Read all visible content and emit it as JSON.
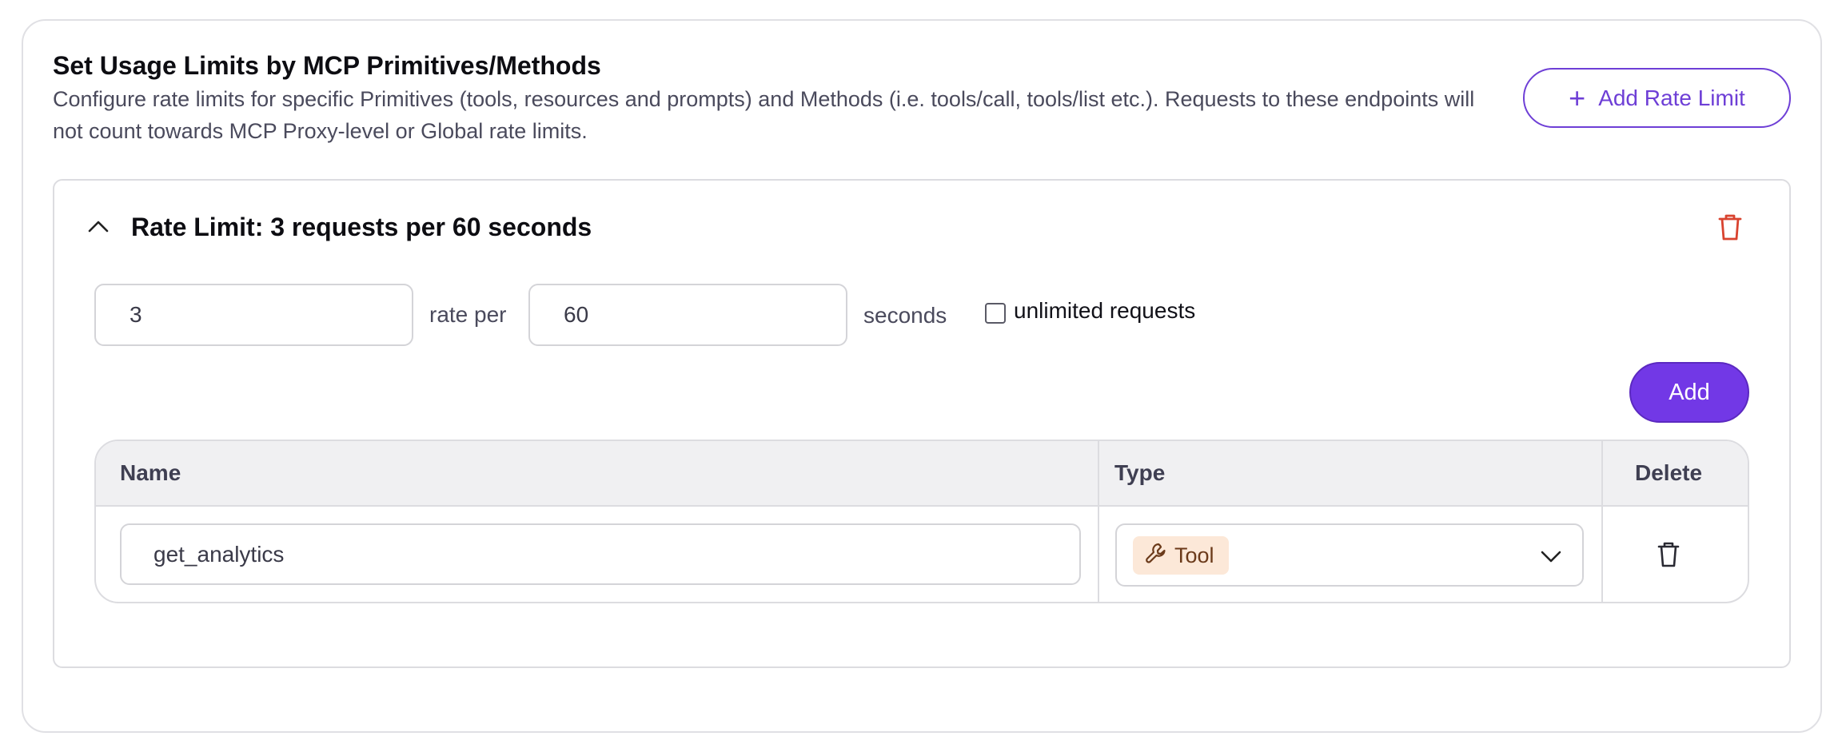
{
  "section": {
    "title": "Set Usage Limits by MCP Primitives/Methods",
    "description": "Configure rate limits for specific Primitives (tools, resources and prompts) and Methods (i.e. tools/call, tools/list etc.). Requests to these endpoints will not count towards MCP Proxy-level or Global rate limits.",
    "add_rate_limit_label": "Add Rate Limit"
  },
  "rate_limit": {
    "title": "Rate Limit: 3 requests per 60 seconds",
    "requests_value": "3",
    "rate_per_label": "rate per",
    "seconds_value": "60",
    "seconds_label": "seconds",
    "unlimited_label": "unlimited requests",
    "unlimited_checked": false,
    "add_label": "Add"
  },
  "table": {
    "headers": {
      "name": "Name",
      "type": "Type",
      "delete": "Delete"
    },
    "rows": [
      {
        "name": "get_analytics",
        "type": "Tool"
      }
    ]
  },
  "colors": {
    "accent": "#7238e6",
    "danger": "#d9432f",
    "tool_badge_bg": "#fce8d8"
  },
  "icons": {
    "add": "plus-icon",
    "collapse": "chevron-up-icon",
    "delete_limit": "trash-icon",
    "tool": "wrench-icon",
    "select": "chevron-down-icon",
    "delete_row": "trash-icon"
  }
}
